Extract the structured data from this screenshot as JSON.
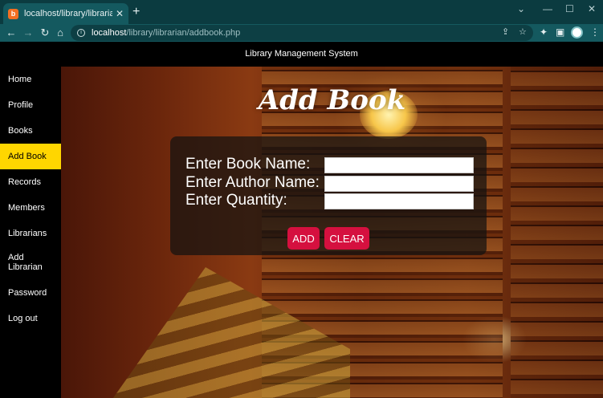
{
  "browser": {
    "tab_title": "localhost/library/librarian/addbo",
    "favicon_text": "b",
    "url_host": "localhost",
    "url_path": "/library/librarian/addbook.php",
    "theme_color": "#14595f"
  },
  "site": {
    "header_title": "Library Management System"
  },
  "sidebar": {
    "items": [
      {
        "label": "Home"
      },
      {
        "label": "Profile"
      },
      {
        "label": "Books"
      },
      {
        "label": "Add Book",
        "active": true
      },
      {
        "label": "Records"
      },
      {
        "label": "Members"
      },
      {
        "label": "Librarians"
      },
      {
        "label": "Add Librarian"
      },
      {
        "label": "Password"
      },
      {
        "label": "Log out"
      }
    ],
    "active_color": "#ffd600"
  },
  "main": {
    "title": "Add Book",
    "form": {
      "book_name_label": "Enter Book Name:",
      "author_name_label": "Enter Author Name:",
      "quantity_label": "Enter Quantity:",
      "book_name_value": "",
      "author_name_value": "",
      "quantity_value": ""
    },
    "buttons": {
      "add_label": "ADD",
      "clear_label": "CLEAR",
      "color": "#d5103f"
    }
  }
}
